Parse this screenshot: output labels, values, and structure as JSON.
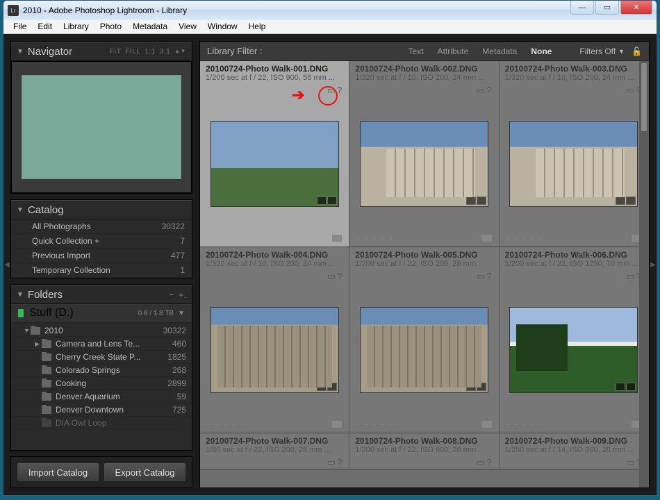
{
  "window": {
    "title": "2010 - Adobe Photoshop Lightroom - Library",
    "appicon": "Lr"
  },
  "menu": [
    "File",
    "Edit",
    "Library",
    "Photo",
    "Metadata",
    "View",
    "Window",
    "Help"
  ],
  "navigator": {
    "title": "Navigator",
    "modes": [
      "FIT",
      "FILL",
      "1:1",
      "3:1"
    ]
  },
  "catalog": {
    "title": "Catalog",
    "rows": [
      {
        "label": "All Photographs",
        "count": "30322"
      },
      {
        "label": "Quick Collection  +",
        "count": "7"
      },
      {
        "label": "Previous Import",
        "count": "477"
      },
      {
        "label": "Temporary Collection",
        "count": "1"
      }
    ]
  },
  "folders": {
    "title": "Folders",
    "volume": {
      "name": "Stuff (D:)",
      "cap": "0.9 / 1.8 TB"
    },
    "root": {
      "name": "2010",
      "count": "30322"
    },
    "items": [
      {
        "name": "Camera and Lens Te...",
        "count": "460"
      },
      {
        "name": "Cherry Creek State P...",
        "count": "1825"
      },
      {
        "name": "Colorado Springs",
        "count": "268"
      },
      {
        "name": "Cooking",
        "count": "2899"
      },
      {
        "name": "Denver Aquarium",
        "count": "59"
      },
      {
        "name": "Denver Downtown",
        "count": "725"
      },
      {
        "name": "DIA Owl Loop",
        "count": ""
      }
    ]
  },
  "buttons": {
    "import": "Import Catalog",
    "export": "Export Catalog"
  },
  "filter": {
    "label": "Library Filter :",
    "tabs": [
      "Text",
      "Attribute",
      "Metadata",
      "None"
    ],
    "active": "None",
    "off": "Filters Off"
  },
  "thumbs": [
    {
      "file": "20100724-Photo Walk-001.DNG",
      "meta": "1/200 sec at f / 22, ISO 900, 56 mm ...",
      "sel": true,
      "cls": "ph-people"
    },
    {
      "file": "20100724-Photo Walk-002.DNG",
      "meta": "1/320 sec at f / 10, ISO 200, 24 mm ...",
      "sel": false,
      "cls": "ph-building"
    },
    {
      "file": "20100724-Photo Walk-003.DNG",
      "meta": "1/320 sec at f / 10, ISO 200, 24 mm ...",
      "sel": false,
      "cls": "ph-building"
    },
    {
      "file": "20100724-Photo Walk-004.DNG",
      "meta": "1/320 sec at f / 10, ISO 200, 24 mm ...",
      "sel": false,
      "cls": "ph-group"
    },
    {
      "file": "20100724-Photo Walk-005.DNG",
      "meta": "1/200 sec at f / 22, ISO 200, 28 mm ...",
      "sel": false,
      "cls": "ph-group"
    },
    {
      "file": "20100724-Photo Walk-006.DNG",
      "meta": "1/200 sec at f / 22, ISO 1250, 70 mm ...",
      "sel": false,
      "cls": "ph-park"
    }
  ],
  "thumbs_row3": [
    {
      "file": "20100724-Photo Walk-007.DNG",
      "meta": "1/80 sec at f / 22, ISO 200, 28 mm ..."
    },
    {
      "file": "20100724-Photo Walk-008.DNG",
      "meta": "1/200 sec at f / 22, ISO 900, 28 mm ..."
    },
    {
      "file": "20100724-Photo Walk-009.DNG",
      "meta": "1/250 sec at f / 14, ISO 360, 28 mm ..."
    }
  ]
}
